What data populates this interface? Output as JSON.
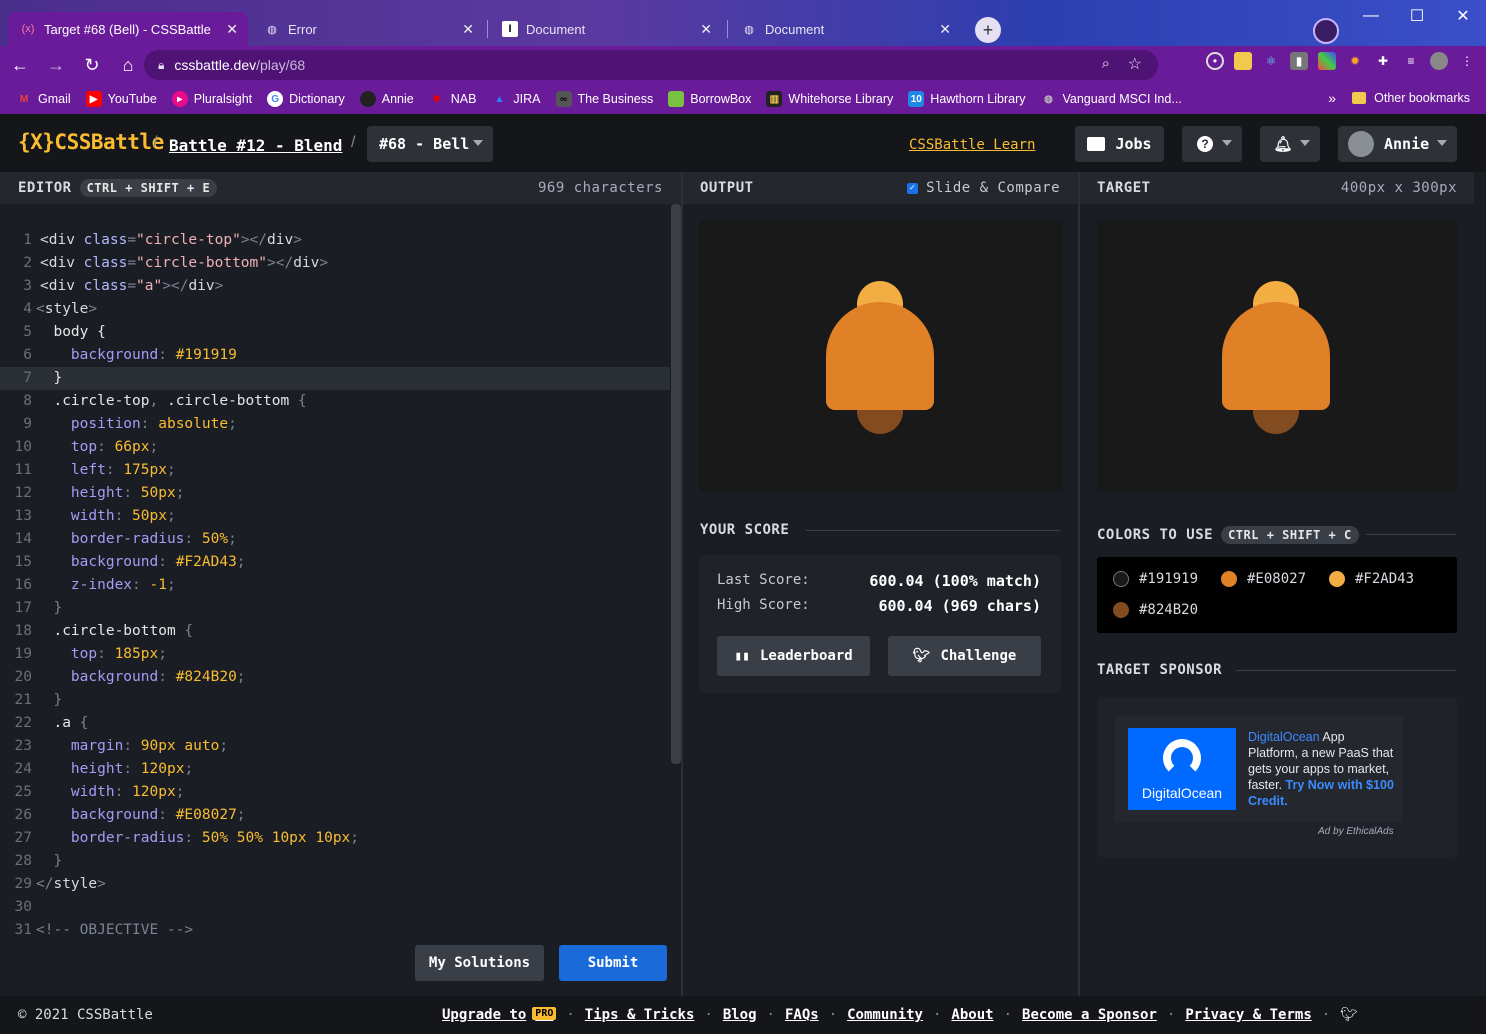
{
  "browser": {
    "tabs": [
      {
        "title": "Target #68 (Bell) - CSSBattle",
        "icon": "cssbattle-icon"
      },
      {
        "title": "Error",
        "icon": "globe-icon"
      },
      {
        "title": "Document",
        "icon": "intellij-icon"
      },
      {
        "title": "Document",
        "icon": "globe-icon"
      }
    ],
    "url_host": "cssbattle.dev",
    "url_path": "/play/68",
    "bookmarks": [
      "Gmail",
      "YouTube",
      "Pluralsight",
      "Dictionary",
      "Annie",
      "NAB",
      "JIRA",
      "The Business",
      "BorrowBox",
      "Whitehorse Library",
      "Hawthorn Library",
      "Vanguard MSCI Ind..."
    ],
    "more_bookmarks": "»",
    "other_bookmarks": "Other bookmarks"
  },
  "header": {
    "logo_text": "{X}CSSBattle",
    "crumb_sep": "/",
    "battle": "Battle #12 - Blend",
    "target": "#68 - Bell",
    "learn": "CSSBattle Learn",
    "jobs": "Jobs",
    "help": "?",
    "user": "Annie"
  },
  "editor": {
    "title": "EDITOR",
    "shortcut": "CTRL + SHIFT + E",
    "char_count": "969 characters",
    "my_solutions": "My Solutions",
    "submit": "Submit"
  },
  "output": {
    "title": "OUTPUT",
    "slide_compare": "Slide & Compare",
    "slide_compare_checked": true
  },
  "target_panel": {
    "title": "TARGET",
    "size": "400px x 300px"
  },
  "score": {
    "title": "YOUR SCORE",
    "last_label": "Last Score:",
    "last_value": "600.04 (100% match)",
    "high_label": "High Score:",
    "high_value": "600.04 (969 chars)",
    "leaderboard": "Leaderboard",
    "challenge": "Challenge"
  },
  "colors": {
    "title": "COLORS TO USE",
    "shortcut": "CTRL + SHIFT + C",
    "list": [
      {
        "hex": "#191919",
        "label": "#191919"
      },
      {
        "hex": "#E08027",
        "label": "#E08027"
      },
      {
        "hex": "#F2AD43",
        "label": "#F2AD43"
      },
      {
        "hex": "#824B20",
        "label": "#824B20"
      }
    ]
  },
  "sponsor": {
    "title": "TARGET SPONSOR",
    "logo_text": "DigitalOcean",
    "brand": "DigitalOcean",
    "text": " App Platform, a new PaaS that gets your apps to market, faster. ",
    "cta": "Try Now with $100 Credit.",
    "ad_by": "Ad by EthicalAds"
  },
  "footer": {
    "copyright": "© 2021 CSSBattle",
    "links": [
      "Upgrade to",
      "Tips & Tricks",
      "Blog",
      "FAQs",
      "Community",
      "About",
      "Become a Sponsor",
      "Privacy & Terms"
    ],
    "pro_badge": "PRO",
    "separator": "·"
  },
  "code_lines": [
    [
      [
        "tag",
        "<div "
      ],
      [
        "attr",
        "class"
      ],
      [
        "punc",
        "="
      ],
      [
        "str",
        "\"circle-top\""
      ],
      [
        "punc",
        "></"
      ],
      [
        "tag",
        "div"
      ],
      [
        "punc",
        ">"
      ]
    ],
    [
      [
        "tag",
        "<div "
      ],
      [
        "attr",
        "class"
      ],
      [
        "punc",
        "="
      ],
      [
        "str",
        "\"circle-bottom\""
      ],
      [
        "punc",
        "></"
      ],
      [
        "tag",
        "div"
      ],
      [
        "punc",
        ">"
      ]
    ],
    [
      [
        "tag",
        "<div "
      ],
      [
        "attr",
        "class"
      ],
      [
        "punc",
        "="
      ],
      [
        "str",
        "\"a\""
      ],
      [
        "punc",
        "></"
      ],
      [
        "tag",
        "div"
      ],
      [
        "punc",
        ">"
      ]
    ],
    [
      [
        "punc",
        "<"
      ],
      [
        "tag",
        "style"
      ],
      [
        "punc",
        ">"
      ]
    ],
    [
      [
        "sel",
        "  body {"
      ]
    ],
    [
      [
        "prop",
        "    background"
      ],
      [
        "punc",
        ": "
      ],
      [
        "val",
        "#191919"
      ]
    ],
    [
      [
        "sel",
        "  }"
      ]
    ],
    [
      [
        "sel",
        "  .circle-top"
      ],
      [
        "punc",
        ", "
      ],
      [
        "sel",
        ".circle-bottom "
      ],
      [
        "punc",
        "{"
      ]
    ],
    [
      [
        "prop",
        "    position"
      ],
      [
        "punc",
        ": "
      ],
      [
        "val",
        "absolute"
      ],
      [
        "punc",
        ";"
      ]
    ],
    [
      [
        "prop",
        "    top"
      ],
      [
        "punc",
        ": "
      ],
      [
        "val",
        "66px"
      ],
      [
        "punc",
        ";"
      ]
    ],
    [
      [
        "prop",
        "    left"
      ],
      [
        "punc",
        ": "
      ],
      [
        "val",
        "175px"
      ],
      [
        "punc",
        ";"
      ]
    ],
    [
      [
        "prop",
        "    height"
      ],
      [
        "punc",
        ": "
      ],
      [
        "val",
        "50px"
      ],
      [
        "punc",
        ";"
      ]
    ],
    [
      [
        "prop",
        "    width"
      ],
      [
        "punc",
        ": "
      ],
      [
        "val",
        "50px"
      ],
      [
        "punc",
        ";"
      ]
    ],
    [
      [
        "prop",
        "    border-radius"
      ],
      [
        "punc",
        ": "
      ],
      [
        "val",
        "50%"
      ],
      [
        "punc",
        ";"
      ]
    ],
    [
      [
        "prop",
        "    background"
      ],
      [
        "punc",
        ": "
      ],
      [
        "val",
        "#F2AD43"
      ],
      [
        "punc",
        ";"
      ]
    ],
    [
      [
        "prop",
        "    z-index"
      ],
      [
        "punc",
        ": "
      ],
      [
        "val",
        "-1"
      ],
      [
        "punc",
        ";"
      ]
    ],
    [
      [
        "punc",
        "  }"
      ]
    ],
    [
      [
        "sel",
        "  .circle-bottom "
      ],
      [
        "punc",
        "{"
      ]
    ],
    [
      [
        "prop",
        "    top"
      ],
      [
        "punc",
        ": "
      ],
      [
        "val",
        "185px"
      ],
      [
        "punc",
        ";"
      ]
    ],
    [
      [
        "prop",
        "    background"
      ],
      [
        "punc",
        ": "
      ],
      [
        "val",
        "#824B20"
      ],
      [
        "punc",
        ";"
      ]
    ],
    [
      [
        "punc",
        "  }"
      ]
    ],
    [
      [
        "sel",
        "  .a "
      ],
      [
        "punc",
        "{"
      ]
    ],
    [
      [
        "prop",
        "    margin"
      ],
      [
        "punc",
        ": "
      ],
      [
        "val",
        "90px auto"
      ],
      [
        "punc",
        ";"
      ]
    ],
    [
      [
        "prop",
        "    height"
      ],
      [
        "punc",
        ": "
      ],
      [
        "val",
        "120px"
      ],
      [
        "punc",
        ";"
      ]
    ],
    [
      [
        "prop",
        "    width"
      ],
      [
        "punc",
        ": "
      ],
      [
        "val",
        "120px"
      ],
      [
        "punc",
        ";"
      ]
    ],
    [
      [
        "prop",
        "    background"
      ],
      [
        "punc",
        ": "
      ],
      [
        "val",
        "#E08027"
      ],
      [
        "punc",
        ";"
      ]
    ],
    [
      [
        "prop",
        "    border-radius"
      ],
      [
        "punc",
        ": "
      ],
      [
        "val",
        "50% 50% 10px 10px"
      ],
      [
        "punc",
        ";"
      ]
    ],
    [
      [
        "punc",
        "  }"
      ]
    ],
    [
      [
        "punc",
        "</"
      ],
      [
        "tag",
        "style"
      ],
      [
        "punc",
        ">"
      ]
    ],
    [
      [
        "tag",
        ""
      ]
    ],
    [
      [
        "com",
        "<!-- OBJECTIVE -->"
      ]
    ]
  ]
}
